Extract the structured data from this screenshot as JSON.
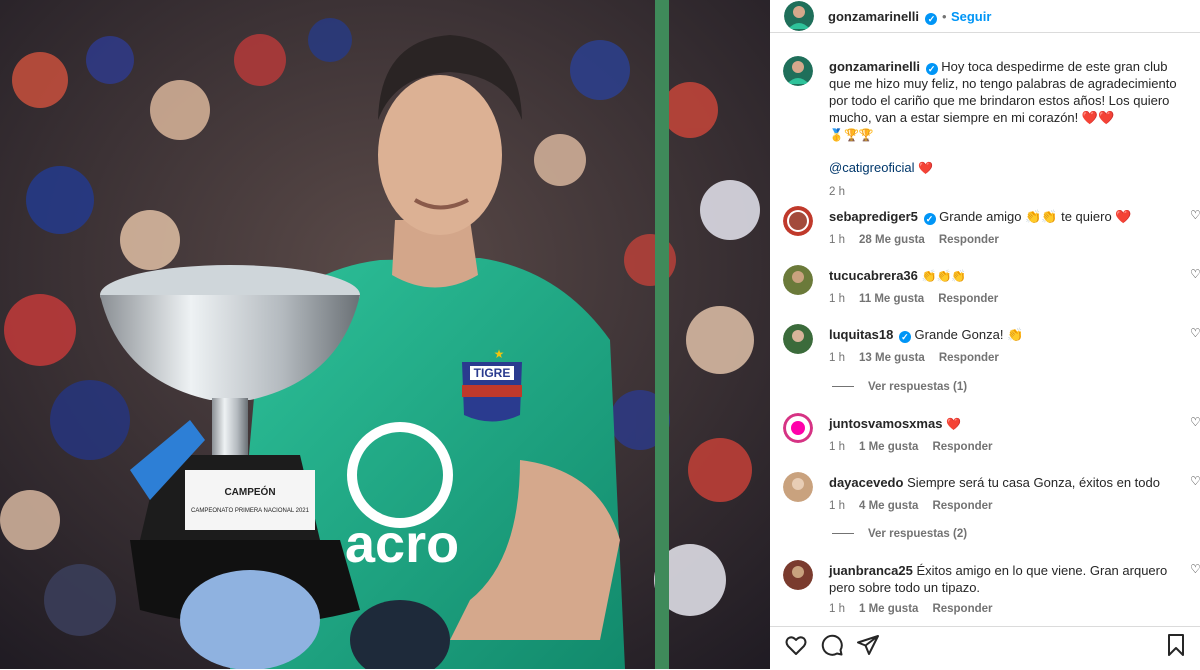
{
  "post": {
    "author": "gonzamarinelli",
    "follow_label": "Seguir",
    "dot": "•",
    "caption": "Hoy toca despedirme de este gran club que me hizo muy feliz, no tengo palabras de agradecimiento por todo el cariño que me brindaron estos años! Los quiero mucho, van a estar siempre en mi corazón! ❤️❤️",
    "caption_emojis": "🥇🏆🏆",
    "mention": "@catigreoficial",
    "mention_emoji": "❤️",
    "time": "2 h"
  },
  "photo": {
    "jersey_badge": "TIGRE",
    "sponsor": "acro",
    "trophy_line1": "CAMPEÓN",
    "trophy_line2": "CAMPEONATO PRIMERA NACIONAL 2021"
  },
  "comments": [
    {
      "user": "sebaprediger5",
      "verified": true,
      "text": "Grande amigo 👏👏 te quiero ❤️",
      "time": "1 h",
      "likes": "28 Me gusta",
      "reply": "Responder",
      "avatar_color": "#c0392b"
    },
    {
      "user": "tucucabrera36",
      "verified": false,
      "text": "👏👏👏",
      "time": "1 h",
      "likes": "11 Me gusta",
      "reply": "Responder",
      "avatar_color": "#6b7a3a"
    },
    {
      "user": "luquitas18",
      "verified": true,
      "text": "Grande Gonza! 👏",
      "time": "1 h",
      "likes": "13 Me gusta",
      "reply": "Responder",
      "avatar_color": "#3b6b3b"
    },
    {
      "user": "juntosvamosxmas",
      "verified": false,
      "text": "❤️",
      "time": "1 h",
      "likes": "1 Me gusta",
      "reply": "Responder",
      "avatar_color": "#d63384"
    },
    {
      "user": "dayacevedo",
      "verified": false,
      "text": "Siempre será tu casa Gonza, éxitos en todo",
      "time": "1 h",
      "likes": "4 Me gusta",
      "reply": "Responder",
      "avatar_color": "#c9a27e"
    },
    {
      "user": "juanbranca25",
      "verified": false,
      "text": "Éxitos amigo en lo que viene. Gran arquero pero sobre todo un tipazo.",
      "time": "1 h",
      "likes": "1 Me gusta",
      "reply": "Responder",
      "avatar_color": "#7a3b2e"
    }
  ],
  "view_replies": [
    "Ver respuestas (1)",
    "Ver respuestas (2)"
  ],
  "icons": {
    "like": "heart-icon",
    "comment": "comment-icon",
    "share": "share-icon",
    "save": "bookmark-icon"
  }
}
